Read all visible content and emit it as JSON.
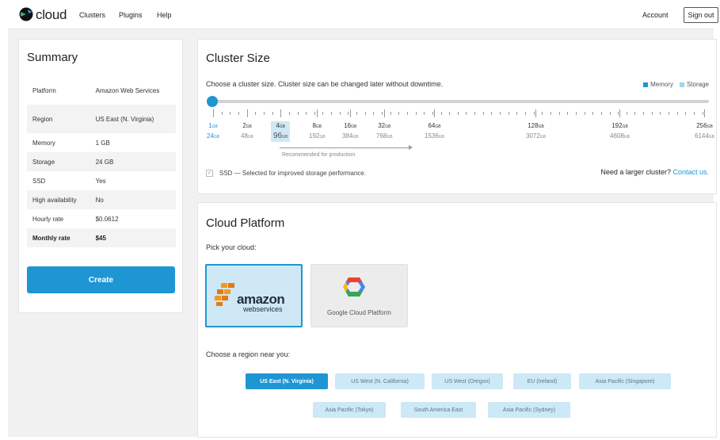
{
  "nav": {
    "logo_text": "cloud",
    "items": [
      "Clusters",
      "Plugins",
      "Help"
    ],
    "account_label": "Account",
    "signout_label": "Sign out"
  },
  "summary": {
    "title": "Summary",
    "rows": [
      {
        "label": "Platform",
        "value": "Amazon Web Services"
      },
      {
        "label": "Region",
        "value": "US East (N. Virginia)"
      },
      {
        "label": "Memory",
        "value": "1 GB"
      },
      {
        "label": "Storage",
        "value": "24 GB"
      },
      {
        "label": "SSD",
        "value": "Yes"
      },
      {
        "label": "High availability",
        "value": "No"
      },
      {
        "label": "Hourly rate",
        "value": "$0.0612"
      },
      {
        "label": "Monthly rate",
        "value": "$45"
      }
    ],
    "create_label": "Create"
  },
  "cluster_size": {
    "title": "Cluster Size",
    "subtitle": "Choose a cluster size. Cluster size can be changed later without downtime.",
    "legend": {
      "memory": "Memory",
      "storage": "Storage"
    },
    "sizes": [
      {
        "mem": "1",
        "st": "24"
      },
      {
        "mem": "2",
        "st": "48"
      },
      {
        "mem": "4",
        "st": "96"
      },
      {
        "mem": "8",
        "st": "192"
      },
      {
        "mem": "16",
        "st": "384"
      },
      {
        "mem": "32",
        "st": "768"
      },
      {
        "mem": "64",
        "st": "1536"
      },
      {
        "mem": "128",
        "st": "3072"
      },
      {
        "mem": "192",
        "st": "4608"
      },
      {
        "mem": "256",
        "st": "6144"
      }
    ],
    "unit": "GB",
    "selected_index": 0,
    "recommended_text": "Recommended for production",
    "ssd_check": "✓",
    "ssd_text": "SSD — Selected for improved storage performance.",
    "larger_text": "Need a larger cluster?",
    "contact_text": "Contact us."
  },
  "cloud_platform": {
    "title": "Cloud Platform",
    "pick_label": "Pick your cloud:",
    "aws": {
      "word": "amazon",
      "sub": "webservices"
    },
    "gcp": {
      "label": "Google Cloud Platform"
    },
    "region_label": "Choose a region near you:",
    "regions": [
      "US East (N. Virginia)",
      "US West (N. California)",
      "US West (Oregon)",
      "EU (Ireland)",
      "Asia Pacific (Singapore)",
      "Asia Pacific (Tokyo)",
      "South America East",
      "Asia Pacific (Sydney)"
    ]
  },
  "colors": {
    "accent": "#1e96d3",
    "storage": "#9fd4f0",
    "aws_orange": "#f7981d"
  }
}
